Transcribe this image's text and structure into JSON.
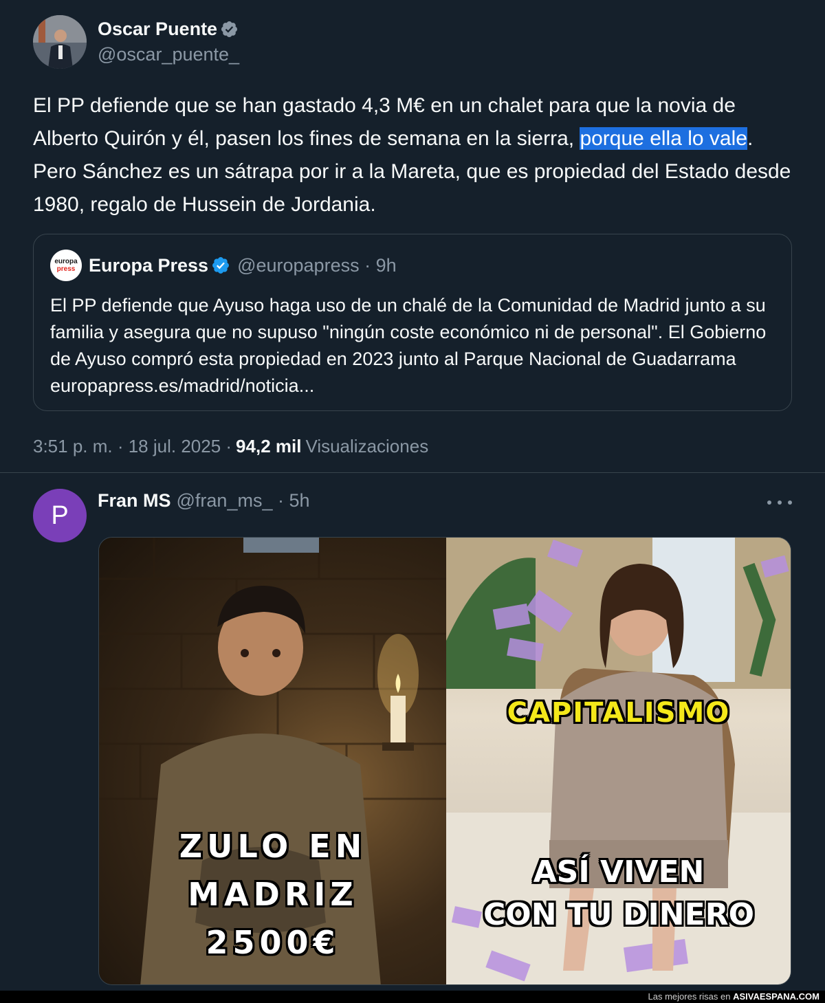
{
  "main_tweet": {
    "author_name": "Oscar Puente",
    "author_handle": "@oscar_puente_",
    "text_before": "El PP defiende que se han gastado 4,3 M€ en un chalet para que la novia de Alberto Quirón y él, pasen los fines de semana en la sierra, ",
    "text_highlight_1": "porque ",
    "text_highlight_2": "ella lo vale",
    "text_after": ". Pero Sánchez es un sátrapa por ir a la Mareta, que es propiedad del Estado desde 1980, regalo de Hussein de Jordania.",
    "timestamp": "3:51 p. m. · 18 jul. 2025 ·",
    "views_count": "94,2 mil",
    "views_label": "Visualizaciones"
  },
  "quoted_tweet": {
    "logo_word_1": "europa",
    "logo_word_2": "press",
    "author_name": "Europa Press",
    "author_handle_time": "@europapress · 9h",
    "text": "El PP defiende que Ayuso haga uso de un chalé de la Comunidad de Madrid junto a su familia y asegura que no supuso \"ningún coste económico ni de personal\". El Gobierno de Ayuso compró esta propiedad en 2023 junto al Parque Nacional de Guadarrama europapress.es/madrid/noticia..."
  },
  "reply_tweet": {
    "avatar_letter": "P",
    "author_name": "Fran MS",
    "author_handle_time": "@fran_ms_ · 5h",
    "meme": {
      "left_line_1": "ZULO EN",
      "left_line_2": "MADRIZ",
      "left_line_3": "2500€",
      "right_top": "CAPITALISMO",
      "right_line_1": "ASÍ VIVEN",
      "right_line_2": "CON TU DINERO"
    }
  },
  "footer": {
    "prefix": "Las mejores risas en ",
    "site": "ASIVAESPANA.COM"
  },
  "colors": {
    "background": "#15202b",
    "border": "#38444d",
    "secondary_text": "#8b98a5",
    "verified_blue": "#1d9bf0",
    "highlight": "#1d6fe0",
    "caption_yellow": "#f4e81a"
  }
}
